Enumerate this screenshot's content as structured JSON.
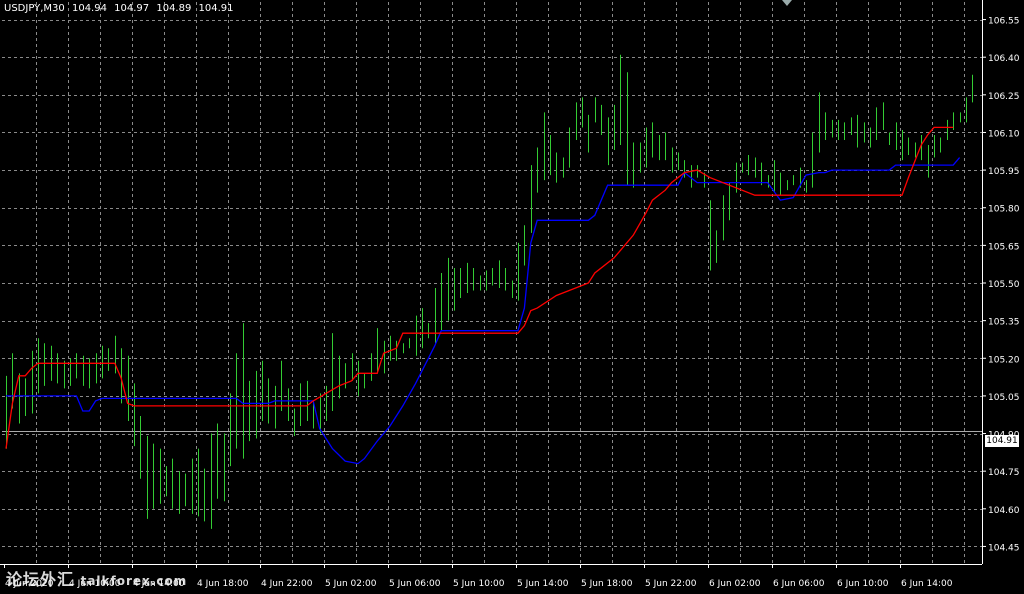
{
  "header": {
    "symbol": "USDJPY,M30",
    "open": "104.94",
    "high": "104.97",
    "low": "104.89",
    "close": "104.91"
  },
  "current_price_label": "104.91",
  "watermark": {
    "text": "论坛外汇",
    "site": "talkforex.com"
  },
  "colors": {
    "background": "#000000",
    "grid": "#8a8a8a",
    "bars": "#33cc33",
    "blue_line": "#0000ff",
    "red_line": "#ff0000",
    "axis_text": "#ffffff"
  },
  "chart_data": {
    "type": "line",
    "ylim": [
      104.38,
      106.62
    ],
    "y_ticks": [
      "106.55",
      "106.40",
      "106.25",
      "106.10",
      "105.95",
      "105.80",
      "105.65",
      "105.50",
      "105.35",
      "105.20",
      "105.05",
      "104.90",
      "104.75",
      "104.60",
      "104.45"
    ],
    "x_ticks": [
      "4 Jun 2020",
      "4 Jun 10:00",
      "4 Jun 14:00",
      "4 Jun 18:00",
      "4 Jun 22:00",
      "5 Jun 02:00",
      "5 Jun 06:00",
      "5 Jun 10:00",
      "5 Jun 14:00",
      "5 Jun 18:00",
      "5 Jun 22:00",
      "6 Jun 02:00",
      "6 Jun 06:00",
      "6 Jun 10:00",
      "6 Jun 14:00"
    ],
    "price_bars_hl": [
      [
        105.13,
        104.84
      ],
      [
        105.22,
        105.0
      ],
      [
        105.14,
        104.94
      ],
      [
        105.12,
        104.97
      ],
      [
        105.23,
        104.98
      ],
      [
        105.28,
        105.06
      ],
      [
        105.26,
        105.09
      ],
      [
        105.25,
        105.11
      ],
      [
        105.22,
        105.1
      ],
      [
        105.19,
        105.08
      ],
      [
        105.2,
        105.09
      ],
      [
        105.22,
        105.12
      ],
      [
        105.21,
        105.09
      ],
      [
        105.2,
        105.08
      ],
      [
        105.22,
        105.1
      ],
      [
        105.25,
        105.12
      ],
      [
        105.24,
        105.15
      ],
      [
        105.29,
        105.14
      ],
      [
        105.24,
        105.02
      ],
      [
        105.21,
        104.95
      ],
      [
        105.1,
        104.85
      ],
      [
        104.97,
        104.72
      ],
      [
        104.89,
        104.56
      ],
      [
        104.86,
        104.6
      ],
      [
        104.84,
        104.62
      ],
      [
        104.77,
        104.65
      ],
      [
        104.8,
        104.6
      ],
      [
        104.75,
        104.58
      ],
      [
        104.74,
        104.61
      ],
      [
        104.8,
        104.58
      ],
      [
        104.84,
        104.57
      ],
      [
        104.76,
        104.55
      ],
      [
        104.9,
        104.52
      ],
      [
        104.94,
        104.64
      ],
      [
        104.9,
        104.63
      ],
      [
        105.06,
        104.77
      ],
      [
        105.22,
        104.84
      ],
      [
        105.34,
        104.8
      ],
      [
        105.11,
        104.87
      ],
      [
        105.15,
        104.88
      ],
      [
        105.19,
        104.95
      ],
      [
        105.12,
        104.94
      ],
      [
        105.09,
        104.92
      ],
      [
        105.19,
        104.99
      ],
      [
        105.08,
        104.95
      ],
      [
        105.0,
        104.89
      ],
      [
        105.1,
        104.93
      ],
      [
        105.11,
        104.95
      ],
      [
        105.03,
        104.92
      ],
      [
        105.06,
        104.9
      ],
      [
        105.09,
        104.95
      ],
      [
        105.3,
        104.99
      ],
      [
        105.21,
        105.04
      ],
      [
        105.18,
        105.08
      ],
      [
        105.22,
        105.11
      ],
      [
        105.19,
        105.05
      ],
      [
        105.14,
        105.08
      ],
      [
        105.22,
        105.11
      ],
      [
        105.32,
        105.14
      ],
      [
        105.27,
        105.14
      ],
      [
        105.29,
        105.19
      ],
      [
        105.27,
        105.19
      ],
      [
        105.26,
        105.22
      ],
      [
        105.28,
        105.24
      ],
      [
        105.37,
        105.21
      ],
      [
        105.4,
        105.24
      ],
      [
        105.34,
        105.28
      ],
      [
        105.48,
        105.26
      ],
      [
        105.54,
        105.31
      ],
      [
        105.6,
        105.35
      ],
      [
        105.56,
        105.39
      ],
      [
        105.56,
        105.44
      ],
      [
        105.58,
        105.46
      ],
      [
        105.56,
        105.47
      ],
      [
        105.53,
        105.47
      ],
      [
        105.55,
        105.47
      ],
      [
        105.56,
        105.49
      ],
      [
        105.59,
        105.48
      ],
      [
        105.56,
        105.47
      ],
      [
        105.51,
        105.44
      ],
      [
        105.66,
        105.43
      ],
      [
        105.73,
        105.57
      ],
      [
        105.97,
        105.7
      ],
      [
        106.04,
        105.86
      ],
      [
        106.18,
        105.91
      ],
      [
        106.09,
        105.93
      ],
      [
        106.02,
        105.9
      ],
      [
        106.0,
        105.92
      ],
      [
        106.12,
        105.96
      ],
      [
        106.22,
        106.07
      ],
      [
        106.24,
        106.12
      ],
      [
        106.17,
        106.02
      ],
      [
        106.24,
        106.14
      ],
      [
        106.21,
        106.09
      ],
      [
        106.16,
        105.97
      ],
      [
        106.21,
        106.03
      ],
      [
        106.41,
        106.05
      ],
      [
        106.34,
        105.89
      ],
      [
        106.06,
        105.88
      ],
      [
        106.06,
        105.94
      ],
      [
        106.12,
        105.96
      ],
      [
        106.14,
        106.0
      ],
      [
        106.09,
        105.99
      ],
      [
        106.1,
        105.99
      ],
      [
        106.04,
        105.94
      ],
      [
        106.02,
        105.95
      ],
      [
        105.99,
        105.92
      ],
      [
        105.97,
        105.88
      ],
      [
        105.97,
        105.92
      ],
      [
        105.94,
        105.88
      ],
      [
        105.83,
        105.55
      ],
      [
        105.71,
        105.58
      ],
      [
        105.85,
        105.67
      ],
      [
        105.9,
        105.75
      ],
      [
        105.98,
        105.86
      ],
      [
        105.98,
        105.94
      ],
      [
        106.01,
        105.93
      ],
      [
        106.0,
        105.92
      ],
      [
        105.98,
        105.89
      ],
      [
        105.93,
        105.88
      ],
      [
        105.99,
        105.86
      ],
      [
        105.94,
        105.85
      ],
      [
        105.91,
        105.87
      ],
      [
        105.93,
        105.89
      ],
      [
        105.96,
        105.88
      ],
      [
        105.91,
        105.86
      ],
      [
        106.1,
        105.88
      ],
      [
        106.26,
        106.02
      ],
      [
        106.18,
        106.07
      ],
      [
        106.15,
        106.08
      ],
      [
        106.15,
        106.07
      ],
      [
        106.14,
        106.07
      ],
      [
        106.16,
        106.09
      ],
      [
        106.17,
        106.04
      ],
      [
        106.14,
        106.06
      ],
      [
        106.12,
        106.04
      ],
      [
        106.2,
        106.07
      ],
      [
        106.22,
        106.11
      ],
      [
        106.1,
        106.05
      ],
      [
        106.14,
        106.03
      ],
      [
        106.11,
        105.99
      ],
      [
        106.08,
        106.01
      ],
      [
        106.06,
        106.0
      ],
      [
        106.09,
        105.99
      ],
      [
        106.05,
        105.92
      ],
      [
        106.09,
        106.0
      ],
      [
        106.08,
        106.02
      ],
      [
        106.15,
        106.07
      ],
      [
        106.18,
        106.11
      ],
      [
        106.18,
        106.14
      ],
      [
        106.24,
        106.14
      ],
      [
        106.33,
        106.22
      ]
    ],
    "series": [
      {
        "color": "#0000ff",
        "points": [
          [
            0,
            105.05
          ],
          [
            11,
            105.05
          ],
          [
            12,
            104.99
          ],
          [
            13,
            104.99
          ],
          [
            14,
            105.03
          ],
          [
            15,
            105.04
          ],
          [
            36,
            105.04
          ],
          [
            37,
            105.02
          ],
          [
            41,
            105.02
          ],
          [
            42,
            105.03
          ],
          [
            48,
            105.03
          ],
          [
            49,
            104.92
          ],
          [
            51,
            104.84
          ],
          [
            53,
            104.79
          ],
          [
            55,
            104.78
          ],
          [
            56,
            104.8
          ],
          [
            58,
            104.87
          ],
          [
            60,
            104.93
          ],
          [
            62,
            105.01
          ],
          [
            64,
            105.1
          ],
          [
            66,
            105.2
          ],
          [
            67,
            105.25
          ],
          [
            68,
            105.31
          ],
          [
            80,
            105.31
          ],
          [
            81,
            105.4
          ],
          [
            82,
            105.66
          ],
          [
            83,
            105.75
          ],
          [
            91,
            105.75
          ],
          [
            92,
            105.77
          ],
          [
            94,
            105.89
          ],
          [
            105,
            105.89
          ],
          [
            106,
            105.94
          ],
          [
            108,
            105.9
          ],
          [
            119,
            105.9
          ],
          [
            121,
            105.83
          ],
          [
            123,
            105.84
          ],
          [
            125,
            105.93
          ],
          [
            127,
            105.94
          ],
          [
            128,
            105.94
          ],
          [
            129,
            105.95
          ],
          [
            138,
            105.95
          ],
          [
            139,
            105.97
          ],
          [
            148,
            105.97
          ],
          [
            149,
            106.0
          ]
        ]
      },
      {
        "color": "#ff0000",
        "points": [
          [
            0,
            104.84
          ],
          [
            1,
            105.02
          ],
          [
            2,
            105.13
          ],
          [
            3,
            105.13
          ],
          [
            4,
            105.16
          ],
          [
            5,
            105.18
          ],
          [
            17,
            105.18
          ],
          [
            18,
            105.12
          ],
          [
            19,
            105.02
          ],
          [
            20,
            105.01
          ],
          [
            47,
            105.01
          ],
          [
            48,
            105.03
          ],
          [
            50,
            105.06
          ],
          [
            52,
            105.09
          ],
          [
            54,
            105.11
          ],
          [
            55,
            105.14
          ],
          [
            58,
            105.14
          ],
          [
            59,
            105.22
          ],
          [
            61,
            105.24
          ],
          [
            62,
            105.3
          ],
          [
            80,
            105.3
          ],
          [
            81,
            105.33
          ],
          [
            82,
            105.39
          ],
          [
            83,
            105.4
          ],
          [
            86,
            105.45
          ],
          [
            88,
            105.47
          ],
          [
            91,
            105.5
          ],
          [
            92,
            105.54
          ],
          [
            95,
            105.6
          ],
          [
            96,
            105.63
          ],
          [
            98,
            105.69
          ],
          [
            100,
            105.78
          ],
          [
            101,
            105.83
          ],
          [
            103,
            105.87
          ],
          [
            104,
            105.9
          ],
          [
            106,
            105.94
          ],
          [
            108,
            105.95
          ],
          [
            110,
            105.92
          ],
          [
            117,
            105.85
          ],
          [
            140,
            105.85
          ],
          [
            141,
            105.92
          ],
          [
            143,
            106.05
          ],
          [
            144,
            106.09
          ],
          [
            145,
            106.12
          ],
          [
            148,
            106.12
          ]
        ]
      }
    ]
  }
}
